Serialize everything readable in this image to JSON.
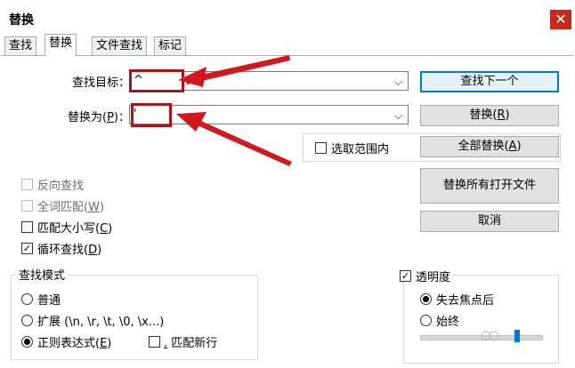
{
  "window": {
    "title": "替换",
    "close_glyph": "✕"
  },
  "tabs": [
    "查找",
    "替换",
    "文件查找",
    "标记"
  ],
  "active_tab": "替换",
  "find": {
    "label": "查找目标：",
    "value": "^"
  },
  "replace": {
    "label_prefix": "替换为(",
    "label_key": "P",
    "label_suffix": ")：",
    "value": "'"
  },
  "buttons": {
    "find_next": "查找下一个",
    "replace": {
      "text": "替换(",
      "key": "R",
      "end": ")"
    },
    "replace_all": {
      "text": "全部替换(",
      "key": "A",
      "end": ")"
    },
    "replace_all_open": "替换所有打开文件",
    "cancel": "取消"
  },
  "in_selection": {
    "label": "选取范围内",
    "checked": false
  },
  "options": [
    {
      "label": "反向查找",
      "checked": false,
      "enabled": false
    },
    {
      "label": "全词匹配(",
      "key": "W",
      "end": ")",
      "checked": false,
      "enabled": false
    },
    {
      "label": "匹配大小写(",
      "key": "C",
      "end": ")",
      "checked": false,
      "enabled": true
    },
    {
      "label": "循环查找(",
      "key": "D",
      "end": ")",
      "checked": true,
      "enabled": true
    }
  ],
  "search_mode": {
    "title": "查找模式",
    "normal": "普通",
    "extended": "扩展 (\\n, \\r, \\t, \\0, \\x...)",
    "regex": {
      "text": "正则表达式(",
      "key": "E",
      "end": ")"
    },
    "selected": "regex",
    "dot_newline": {
      "key": ".",
      "text": " 匹配新行",
      "checked": false
    }
  },
  "transparency": {
    "title": "透明度",
    "enabled": true,
    "on_lose_focus": "失去焦点后",
    "always": "始终",
    "selected": "on_lose_focus",
    "level": 0.8
  },
  "colors": {
    "arrow": "#d1171f",
    "box": "#a4161a",
    "accent": "#0078d7"
  }
}
